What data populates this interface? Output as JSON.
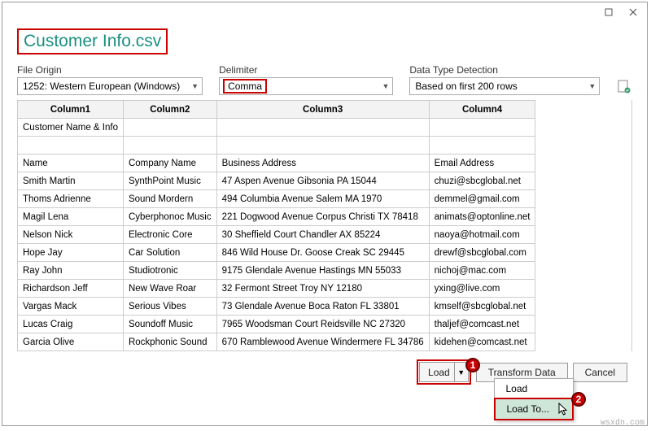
{
  "window": {
    "title": "Customer Info.csv"
  },
  "options": {
    "file_origin_label": "File Origin",
    "file_origin_value": "1252: Western European (Windows)",
    "delimiter_label": "Delimiter",
    "delimiter_value": "Comma",
    "detection_label": "Data Type Detection",
    "detection_value": "Based on first 200 rows"
  },
  "table": {
    "headers": [
      "Column1",
      "Column2",
      "Column3",
      "Column4"
    ],
    "rows": [
      [
        "Customer Name & Info",
        "",
        "",
        ""
      ],
      [
        "",
        "",
        "",
        ""
      ],
      [
        "Name",
        "Company Name",
        "Business Address",
        "Email Address"
      ],
      [
        "Smith Martin",
        "SynthPoint Music",
        "47 Aspen Avenue Gibsonia PA 15044",
        "chuzi@sbcglobal.net"
      ],
      [
        "Thoms Adrienne",
        "Sound Mordern",
        "494 Columbia Avenue Salem MA 1970",
        "demmel@gmail.com"
      ],
      [
        "Magil Lena",
        "Cyberphonoc Music",
        "221 Dogwood Avenue Corpus Christi TX 78418",
        "animats@optonline.net"
      ],
      [
        "Nelson Nick",
        "Electronic Core",
        "30 Sheffield Court Chandler AX 85224",
        "naoya@hotmail.com"
      ],
      [
        "Hope Jay",
        "Car Solution",
        "846 Wild House Dr. Goose Creak SC 29445",
        "drewf@sbcglobal.com"
      ],
      [
        "Ray John",
        "Studiotronic",
        "9175 Glendale Avenue Hastings MN 55033",
        "nichoj@mac.com"
      ],
      [
        "Richardson Jeff",
        "New Wave Roar",
        "32 Fermont Street Troy NY 12180",
        "yxing@live.com"
      ],
      [
        "Vargas Mack",
        "Serious Vibes",
        "73 Glendale Avenue Boca Raton FL 33801",
        "kmself@sbcglobal.net"
      ],
      [
        "Lucas Craig",
        "Soundoff Music",
        "7965 Woodsman Court Reidsville NC 27320",
        "thaljef@comcast.net"
      ],
      [
        "Garcia Olive",
        "Rockphonic Sound",
        "670 Ramblewood Avenue Windermere FL 34786",
        "kidehen@comcast.net"
      ]
    ]
  },
  "buttons": {
    "load": "Load",
    "transform": "Transform Data",
    "cancel": "Cancel",
    "menu_load": "Load",
    "menu_load_to": "Load To..."
  },
  "callouts": {
    "one": "1",
    "two": "2"
  },
  "watermark": "wsxdn.com"
}
